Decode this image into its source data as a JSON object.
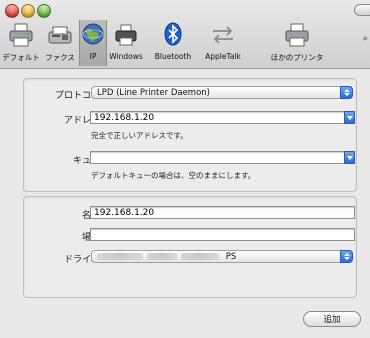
{
  "toolbar": {
    "items": [
      {
        "label": "デフォルト",
        "icon": "printer-icon"
      },
      {
        "label": "ファクス",
        "icon": "fax-icon"
      },
      {
        "label": "IP",
        "icon": "globe-icon"
      },
      {
        "label": "Windows",
        "icon": "windows-printer-icon"
      },
      {
        "label": "Bluetooth",
        "icon": "bluetooth-icon"
      },
      {
        "label": "AppleTalk",
        "icon": "appletalk-icon"
      },
      {
        "label": "ほかのプリンタ",
        "icon": "other-printer-icon"
      }
    ],
    "overflow": "»"
  },
  "connection": {
    "protocol_label": "プロトコル：",
    "protocol_value": "LPD (Line Printer Daemon)",
    "address_label": "アドレス：",
    "address_value": "192.168.1.20",
    "address_hint": "完全で正しいアドレスです。",
    "queue_label": "キュー：",
    "queue_value": "",
    "queue_hint": "デフォルトキューの場合は、空のままにします。"
  },
  "printer_info": {
    "name_label": "名前：",
    "name_value": "192.168.1.20",
    "location_label": "場所：",
    "location_value": "",
    "driver_label": "ドライバ：",
    "driver_value": "PS"
  },
  "actions": {
    "add_label": "追加"
  },
  "colors": {
    "selected_tab": "#a9a9a9",
    "accent_blue": "#2d6ad0",
    "close": "#d3231a",
    "minimize": "#d9a01c",
    "zoom": "#3e9e1f"
  }
}
